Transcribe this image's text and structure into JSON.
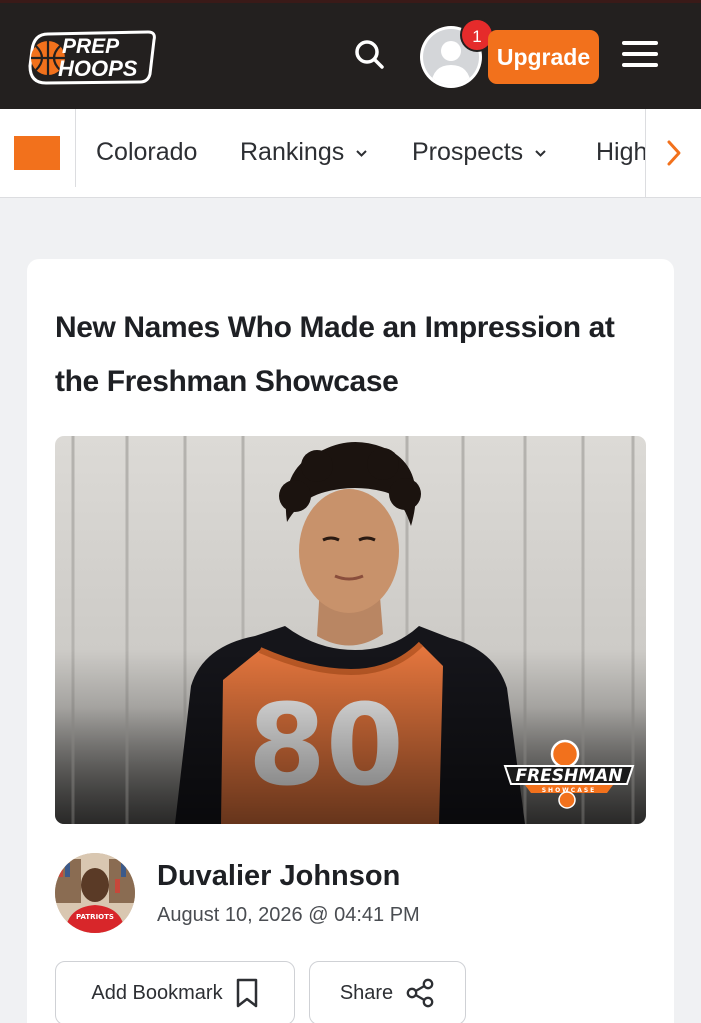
{
  "header": {
    "logo_line1": "PREP",
    "logo_line2": "HOOPS",
    "notification_count": "1",
    "upgrade_label": "Upgrade",
    "colors": {
      "bg": "#23201f",
      "accent": "#f2711c",
      "badge": "#e52b2b"
    }
  },
  "subnav": {
    "items": [
      {
        "label": "Colorado",
        "dropdown": false
      },
      {
        "label": "Rankings",
        "dropdown": true
      },
      {
        "label": "Prospects",
        "dropdown": true
      },
      {
        "label": "High",
        "dropdown": false
      }
    ],
    "next_icon": "chevron-right-icon"
  },
  "article": {
    "title": "New Names Who Made an Impression at the Freshman Showcase",
    "image": {
      "jersey_number": "80",
      "event_logo_line1": "FRESHMAN",
      "event_logo_line2": "SHOWCASE"
    },
    "author": {
      "name": "Duvalier Johnson",
      "shirt_text": "PATRIOTS",
      "date": "August 10, 2026 @ 04:41 PM"
    },
    "actions": {
      "bookmark_label": "Add Bookmark",
      "bookmark_icon": "bookmark-icon",
      "share_label": "Share",
      "share_icon": "share-icon"
    }
  }
}
